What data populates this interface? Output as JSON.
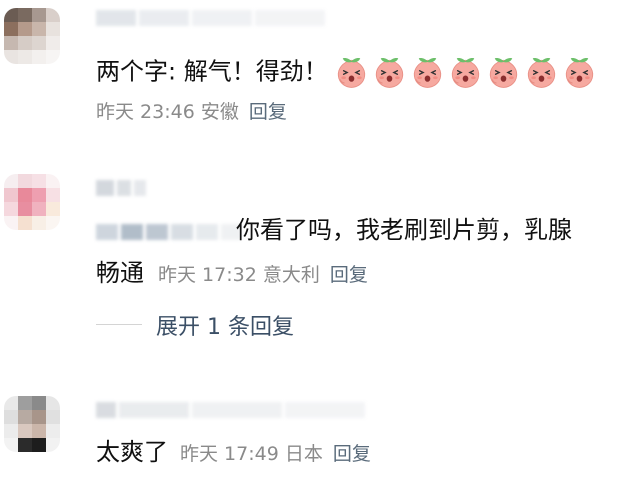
{
  "comments": [
    {
      "text_prefix": "两个字: 解气！得劲！",
      "emoji_count": 7,
      "emoji_name": "peach-emoji",
      "time": "昨天 23:46",
      "location": "安徽",
      "reply": "回复"
    },
    {
      "text_line1": "你看了吗，我老刷到片剪，乳腺",
      "text_line2": "畅通",
      "time": "昨天 17:32",
      "location": "意大利",
      "reply": "回复",
      "expand_label": "展开 1 条回复"
    },
    {
      "text": "太爽了",
      "time": "昨天 17:49",
      "location": "日本",
      "reply": "回复"
    }
  ],
  "colors": {
    "meta_gray": "#8a8a8a",
    "reply_blue": "#5a6b7b",
    "expand_blue": "#3b4f66",
    "peach": "#f6a9a0",
    "leaf": "#6dbf6a"
  }
}
